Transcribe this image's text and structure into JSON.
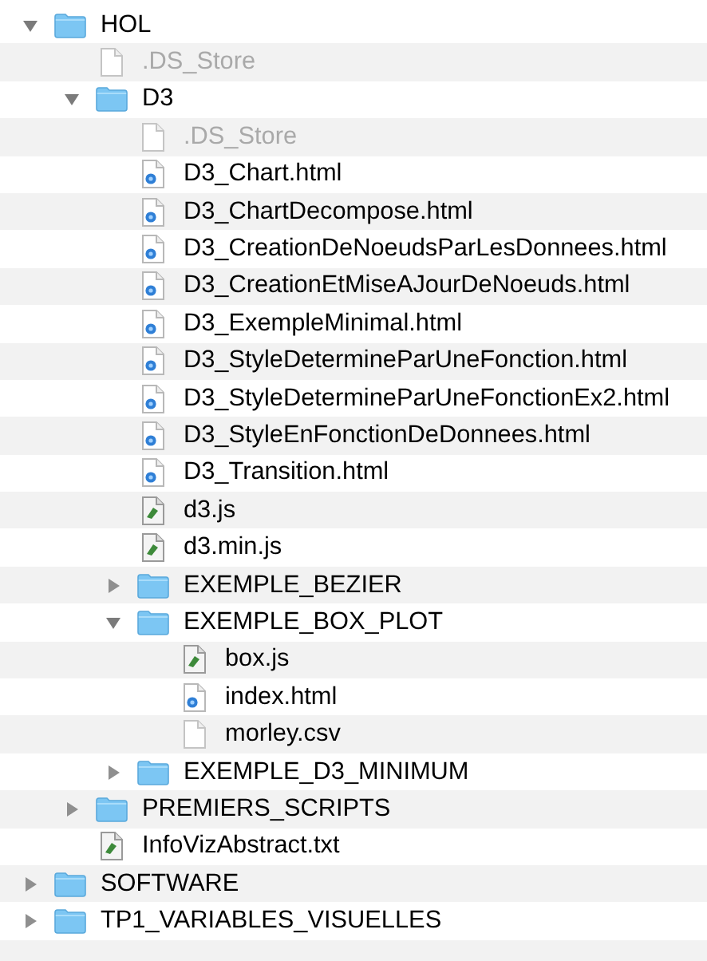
{
  "items": [
    {
      "name": "HOL",
      "kind": "folder",
      "expanded": true,
      "dimmed": false,
      "children": [
        {
          "name": ".DS_Store",
          "kind": "document",
          "dimmed": true
        },
        {
          "name": "D3",
          "kind": "folder",
          "expanded": true,
          "dimmed": false,
          "children": [
            {
              "name": ".DS_Store",
              "kind": "document",
              "dimmed": true
            },
            {
              "name": "D3_Chart.html",
              "kind": "html",
              "dimmed": false
            },
            {
              "name": "D3_ChartDecompose.html",
              "kind": "html",
              "dimmed": false
            },
            {
              "name": "D3_CreationDeNoeudsParLesDonnees.html",
              "kind": "html",
              "dimmed": false
            },
            {
              "name": "D3_CreationEtMiseAJourDeNoeuds.html",
              "kind": "html",
              "dimmed": false
            },
            {
              "name": "D3_ExempleMinimal.html",
              "kind": "html",
              "dimmed": false
            },
            {
              "name": "D3_StyleDetermineParUneFonction.html",
              "kind": "html",
              "dimmed": false
            },
            {
              "name": "D3_StyleDetermineParUneFonctionEx2.html",
              "kind": "html",
              "dimmed": false
            },
            {
              "name": "D3_StyleEnFonctionDeDonnees.html",
              "kind": "html",
              "dimmed": false
            },
            {
              "name": "D3_Transition.html",
              "kind": "html",
              "dimmed": false
            },
            {
              "name": "d3.js",
              "kind": "script",
              "dimmed": false
            },
            {
              "name": "d3.min.js",
              "kind": "script",
              "dimmed": false
            },
            {
              "name": "EXEMPLE_BEZIER",
              "kind": "folder",
              "expanded": false,
              "dimmed": false
            },
            {
              "name": "EXEMPLE_BOX_PLOT",
              "kind": "folder",
              "expanded": true,
              "dimmed": false,
              "children": [
                {
                  "name": "box.js",
                  "kind": "script",
                  "dimmed": false
                },
                {
                  "name": "index.html",
                  "kind": "html",
                  "dimmed": false
                },
                {
                  "name": "morley.csv",
                  "kind": "document",
                  "dimmed": false
                }
              ]
            },
            {
              "name": "EXEMPLE_D3_MINIMUM",
              "kind": "folder",
              "expanded": false,
              "dimmed": false
            }
          ]
        },
        {
          "name": "PREMIERS_SCRIPTS",
          "kind": "folder",
          "expanded": false,
          "dimmed": false
        },
        {
          "name": "InfoVizAbstract.txt",
          "kind": "script",
          "dimmed": false
        }
      ]
    },
    {
      "name": "SOFTWARE",
      "kind": "folder",
      "expanded": false,
      "dimmed": false
    },
    {
      "name": "TP1_VARIABLES_VISUELLES",
      "kind": "folder",
      "expanded": false,
      "dimmed": false
    }
  ]
}
